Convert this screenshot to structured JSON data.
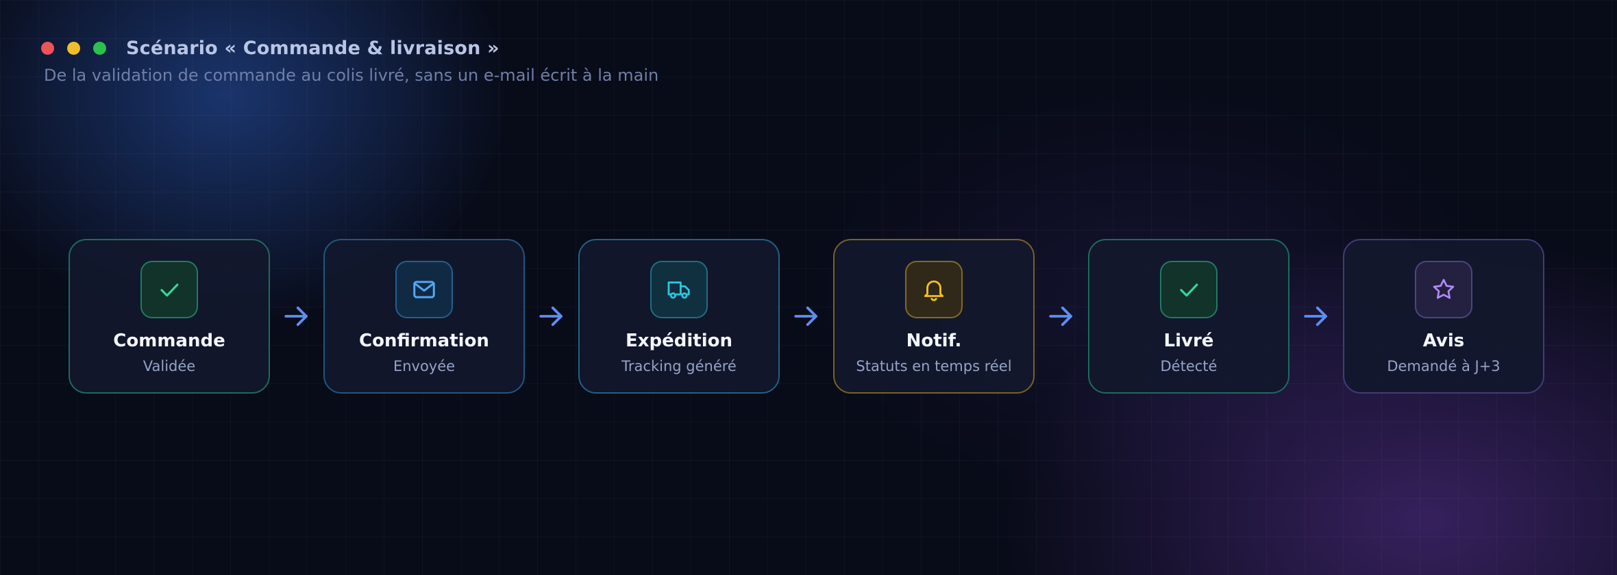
{
  "header": {
    "title": "Scénario « Commande & livraison »",
    "subtitle": "De la validation de commande au colis livré, sans un e-mail écrit à la main"
  },
  "window_controls": [
    "close",
    "minimize",
    "maximize"
  ],
  "steps": [
    {
      "title": "Commande",
      "subtitle": "Validée",
      "icon": "check-icon",
      "accent": "#38d69a"
    },
    {
      "title": "Confirmation",
      "subtitle": "Envoyée",
      "icon": "mail-icon",
      "accent": "#53a7f2"
    },
    {
      "title": "Expédition",
      "subtitle": "Tracking généré",
      "icon": "truck-icon",
      "accent": "#2fc4e0"
    },
    {
      "title": "Notif.",
      "subtitle": "Statuts en temps réel",
      "icon": "bell-icon",
      "accent": "#f4bf24"
    },
    {
      "title": "Livré",
      "subtitle": "Détecté",
      "icon": "check-icon",
      "accent": "#38d69a"
    },
    {
      "title": "Avis",
      "subtitle": "Demandé à J+3",
      "icon": "star-icon",
      "accent": "#ad8cf6"
    }
  ],
  "colors": {
    "background": "#080b18",
    "arrow": "#5d8ff0"
  }
}
